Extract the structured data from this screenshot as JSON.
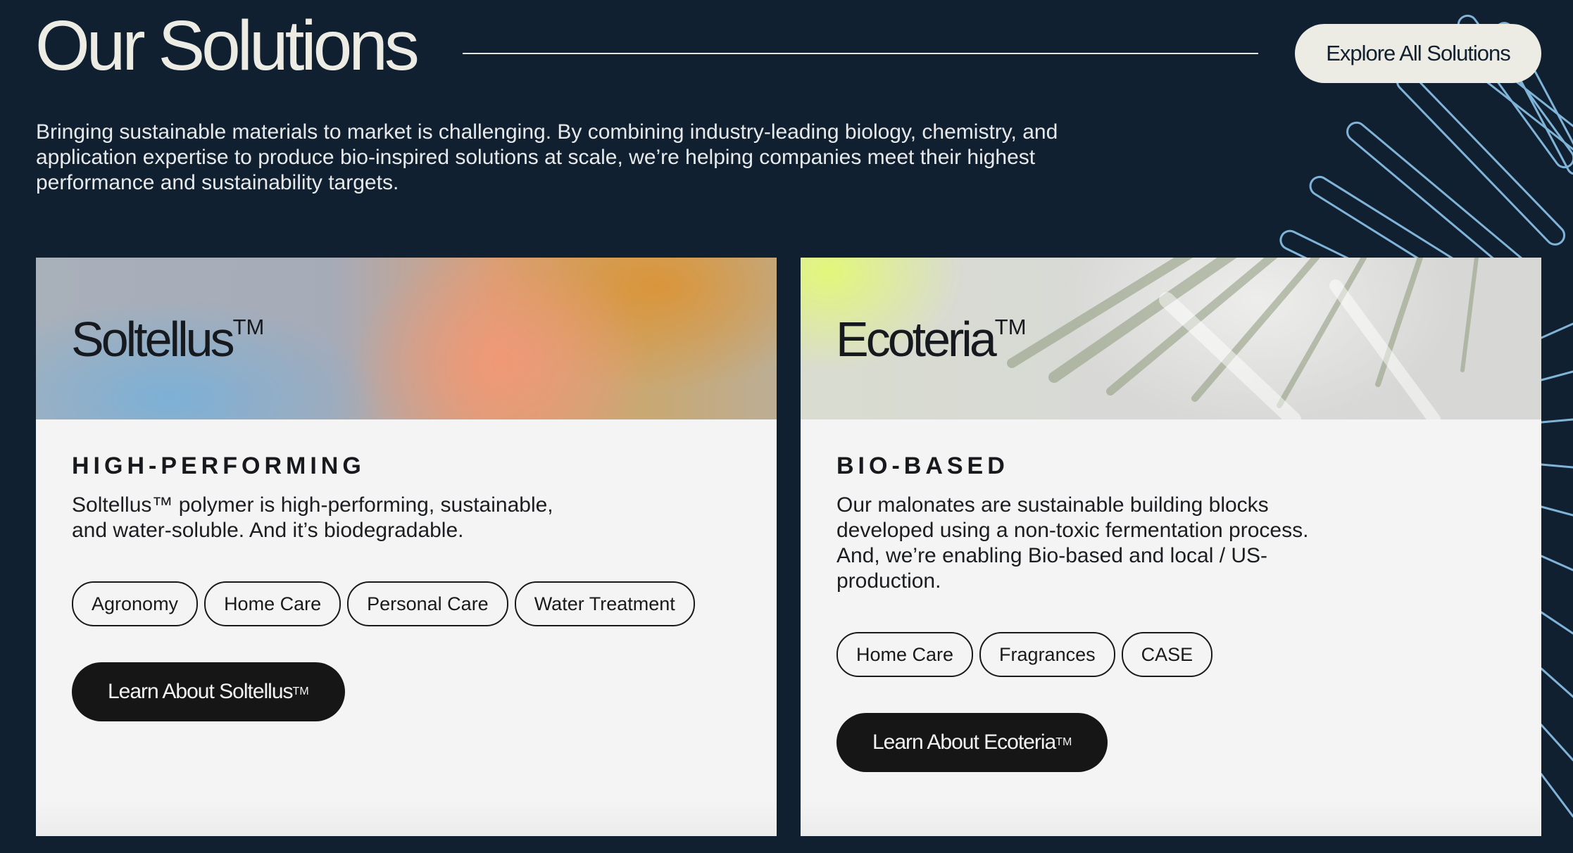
{
  "header": {
    "title": "Our Solutions",
    "explore_button": "Explore All Solutions",
    "intro": "Bringing sustainable materials to market is challenging. By combining industry-leading biology, chemistry, and application expertise to produce bio-inspired solutions at scale, we’re helping companies meet their highest performance and sustainability targets."
  },
  "solutions": [
    {
      "name": "Soltellus",
      "trademark": "TM",
      "eyebrow": "HIGH-PERFORMING",
      "description": "Soltellus™ polymer is high-performing, sustainable, and water-soluble. And it’s biodegradable.",
      "tags": [
        "Agronomy",
        "Home Care",
        "Personal Care",
        "Water Treatment"
      ],
      "cta_label": "Learn About Soltellus",
      "cta_trademark": "TM"
    },
    {
      "name": "Ecoteria",
      "trademark": "TM",
      "eyebrow": "BIO-BASED",
      "description": "Our malonates are sustainable building blocks developed using a non-toxic fermentation process. And, we’re enabling Bio-based and local / US-production.",
      "tags": [
        "Home Care",
        "Fragrances",
        "CASE"
      ],
      "cta_label": "Learn About Ecoteria",
      "cta_trademark": "TM"
    }
  ],
  "colors": {
    "background": "#102031",
    "card": "#f4f4f4",
    "accent_line": "#7fb4d8",
    "button_dark": "#161616",
    "button_light": "#ecebe4"
  }
}
